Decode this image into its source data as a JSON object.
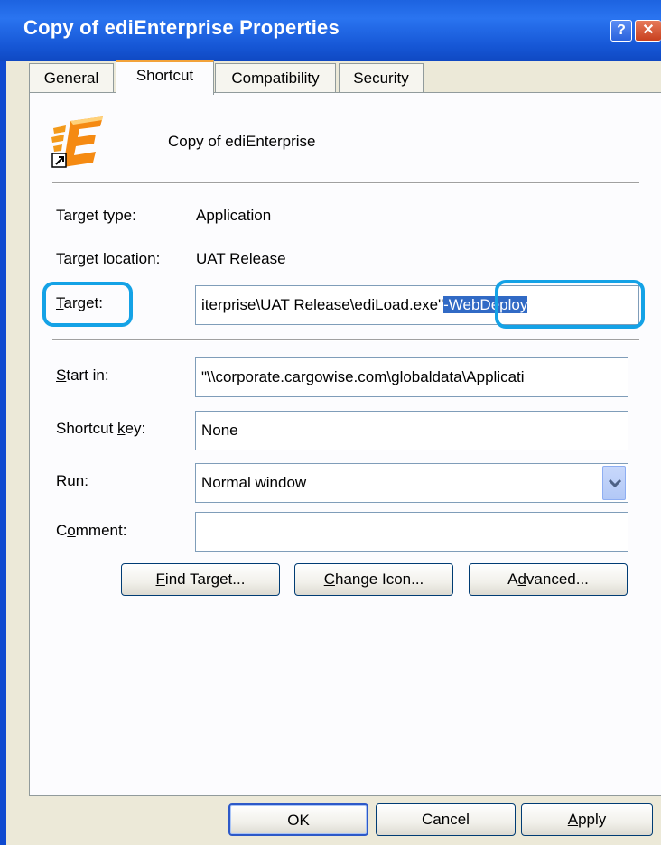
{
  "window": {
    "title": "Copy of ediEnterprise Properties",
    "help_glyph": "?",
    "close_glyph": "✕"
  },
  "tabs": [
    {
      "label": "General",
      "active": false
    },
    {
      "label": "Shortcut",
      "active": true
    },
    {
      "label": "Compatibility",
      "active": false
    },
    {
      "label": "Security",
      "active": false
    }
  ],
  "shortcut": {
    "name": "Copy of ediEnterprise",
    "icon": "ediEnterprise-app-icon",
    "target_type_label": "Target type:",
    "target_type_value": "Application",
    "target_location_label": "Target location:",
    "target_location_value": "UAT Release",
    "target_label": "Target:",
    "target_value_visible": "iterprise\\UAT Release\\ediLoad.exe\"",
    "target_value_selected": "-WebDeploy",
    "start_in_label": "Start in:",
    "start_in_value": "\"\\\\corporate.cargowise.com\\globaldata\\Applicati",
    "shortcut_key_label": "Shortcut key:",
    "shortcut_key_value": "None",
    "run_label": "Run:",
    "run_value": "Normal window",
    "comment_label": "Comment:",
    "comment_value": ""
  },
  "buttons": {
    "find_target": "Find Target...",
    "change_icon": "Change Icon...",
    "advanced": "Advanced...",
    "ok": "OK",
    "cancel": "Cancel",
    "apply": "Apply"
  },
  "colors": {
    "titlebar": "#1d63e0",
    "highlight_ring": "#14a2e6",
    "selection": "#316ac5",
    "active_tab_accent": "#f2a23a"
  }
}
